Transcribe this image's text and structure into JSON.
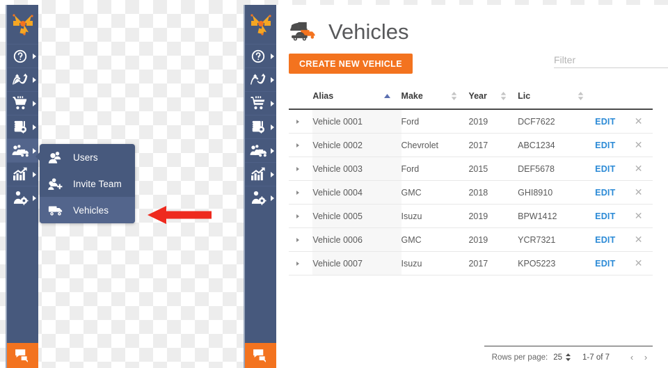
{
  "sidebar": {
    "logo_icon": "routing-arrows-logo-icon",
    "items": [
      {
        "icon": "question-mark-circle-icon",
        "label": "Help",
        "active": false
      },
      {
        "icon": "route-optimization-icon",
        "label": "Routes",
        "active": false
      },
      {
        "icon": "shopping-cart-icon",
        "label": "Orders",
        "active": false
      },
      {
        "icon": "clipboard-location-icon",
        "label": "Addresses",
        "active": false
      },
      {
        "icon": "team-truck-icon",
        "label": "Team",
        "active": true
      },
      {
        "icon": "growth-chart-icon",
        "label": "Reports",
        "active": false
      },
      {
        "icon": "user-settings-icon",
        "label": "Account",
        "active": false
      }
    ],
    "chat_button": {
      "icon": "chat-bubbles-icon",
      "label": "Chat",
      "color": "#f3731f"
    },
    "colors": {
      "background": "#47597d",
      "active": "#53658c",
      "edge": "#9aa7bd"
    }
  },
  "flyout": {
    "items": [
      {
        "icon": "users-icon",
        "label": "Users",
        "selected": false
      },
      {
        "icon": "invite-team-icon",
        "label": "Invite Team",
        "selected": false
      },
      {
        "icon": "vehicle-truck-icon",
        "label": "Vehicles",
        "selected": true
      }
    ]
  },
  "annotation": {
    "icon": "red-left-arrow-icon",
    "color": "#ee2a1e"
  },
  "page": {
    "icon": "vehicles-fleet-icon",
    "title": "Vehicles"
  },
  "toolbar": {
    "create_label": "CREATE NEW VEHICLE",
    "create_color": "#f3731f",
    "filter_icon": "filter-funnel-icon",
    "filter_placeholder": "Filter",
    "filter_value": ""
  },
  "table": {
    "columns": [
      {
        "key": "expand",
        "label": "",
        "sortable": false,
        "sort": "none"
      },
      {
        "key": "alias",
        "label": "Alias",
        "sortable": true,
        "sort": "asc"
      },
      {
        "key": "make",
        "label": "Make",
        "sortable": true,
        "sort": "none"
      },
      {
        "key": "year",
        "label": "Year",
        "sortable": true,
        "sort": "none"
      },
      {
        "key": "lic",
        "label": "Lic",
        "sortable": true,
        "sort": "none"
      },
      {
        "key": "actions",
        "label": "",
        "sortable": false,
        "sort": "none"
      }
    ],
    "edit_label": "EDIT",
    "delete_icon": "close-x-icon",
    "expand_icon": "chevron-right-icon",
    "sort_active_color": "#5b6fb0",
    "rows": [
      {
        "alias": "Vehicle 0001",
        "make": "Ford",
        "year": "2019",
        "lic": "DCF7622"
      },
      {
        "alias": "Vehicle 0002",
        "make": "Chevrolet",
        "year": "2017",
        "lic": "ABC1234"
      },
      {
        "alias": "Vehicle 0003",
        "make": "Ford",
        "year": "2015",
        "lic": "DEF5678"
      },
      {
        "alias": "Vehicle 0004",
        "make": "GMC",
        "year": "2018",
        "lic": "GHI8910"
      },
      {
        "alias": "Vehicle 0005",
        "make": "Isuzu",
        "year": "2019",
        "lic": "BPW1412"
      },
      {
        "alias": "Vehicle 0006",
        "make": "GMC",
        "year": "2019",
        "lic": "YCR7321"
      },
      {
        "alias": "Vehicle 0007",
        "make": "Isuzu",
        "year": "2017",
        "lic": "KPO5223"
      }
    ]
  },
  "paginator": {
    "rows_per_page_label": "Rows per page:",
    "rows_per_page_value": "25",
    "range_label": "1-7 of 7",
    "prev_icon": "chevron-left-icon",
    "next_icon": "chevron-right-icon",
    "prev_glyph": "‹",
    "next_glyph": "›"
  }
}
